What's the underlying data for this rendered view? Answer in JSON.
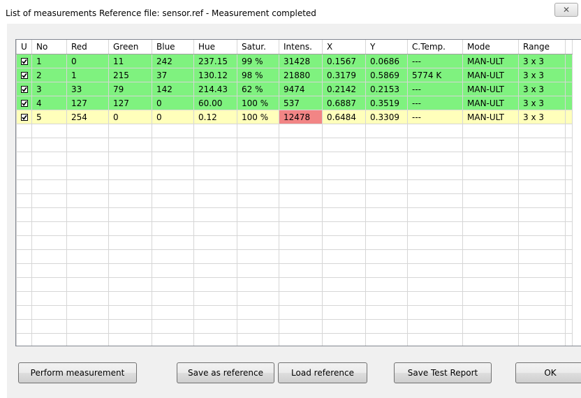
{
  "window": {
    "title": "List of measurements  Reference file: sensor.ref - Measurement completed",
    "close_glyph": "✕"
  },
  "columns": [
    "U",
    "No",
    "Red",
    "Green",
    "Blue",
    "Hue",
    "Satur.",
    "Intens.",
    "X",
    "Y",
    "C.Temp.",
    "Mode",
    "Range"
  ],
  "rows": [
    {
      "status": "ok",
      "checked": true,
      "no": "1",
      "red": "0",
      "green": "11",
      "blue": "242",
      "hue": "237.15",
      "satur": "99 %",
      "intens": "31428",
      "x": "0.1567",
      "y": "0.0686",
      "ctemp": "---",
      "mode": "MAN-ULT",
      "range": "3 x 3",
      "intens_flag": false
    },
    {
      "status": "ok",
      "checked": true,
      "no": "2",
      "red": "1",
      "green": "215",
      "blue": "37",
      "hue": "130.12",
      "satur": "98 %",
      "intens": "21880",
      "x": "0.3179",
      "y": "0.5869",
      "ctemp": "5774 K",
      "mode": "MAN-ULT",
      "range": "3 x 3",
      "intens_flag": false
    },
    {
      "status": "ok",
      "checked": true,
      "no": "3",
      "red": "33",
      "green": "79",
      "blue": "142",
      "hue": "214.43",
      "satur": "62 %",
      "intens": "9474",
      "x": "0.2142",
      "y": "0.2153",
      "ctemp": "---",
      "mode": "MAN-ULT",
      "range": "3 x 3",
      "intens_flag": false
    },
    {
      "status": "ok",
      "checked": true,
      "no": "4",
      "red": "127",
      "green": "127",
      "blue": "0",
      "hue": "60.00",
      "satur": "100 %",
      "intens": "537",
      "x": "0.6887",
      "y": "0.3519",
      "ctemp": "---",
      "mode": "MAN-ULT",
      "range": "3 x 3",
      "intens_flag": false
    },
    {
      "status": "warn",
      "checked": true,
      "no": "5",
      "red": "254",
      "green": "0",
      "blue": "0",
      "hue": "0.12",
      "satur": "100 %",
      "intens": "12478",
      "x": "0.6484",
      "y": "0.3309",
      "ctemp": "---",
      "mode": "MAN-ULT",
      "range": "3 x 3",
      "intens_flag": true
    }
  ],
  "buttons": {
    "perform": "Perform measurement",
    "save_ref": "Save as reference",
    "load_ref": "Load reference",
    "save_report": "Save Test Report",
    "ok": "OK"
  },
  "colors": {
    "row_ok": "#7ff27f",
    "row_warn": "#ffffbb",
    "cell_alert": "#f28585"
  }
}
